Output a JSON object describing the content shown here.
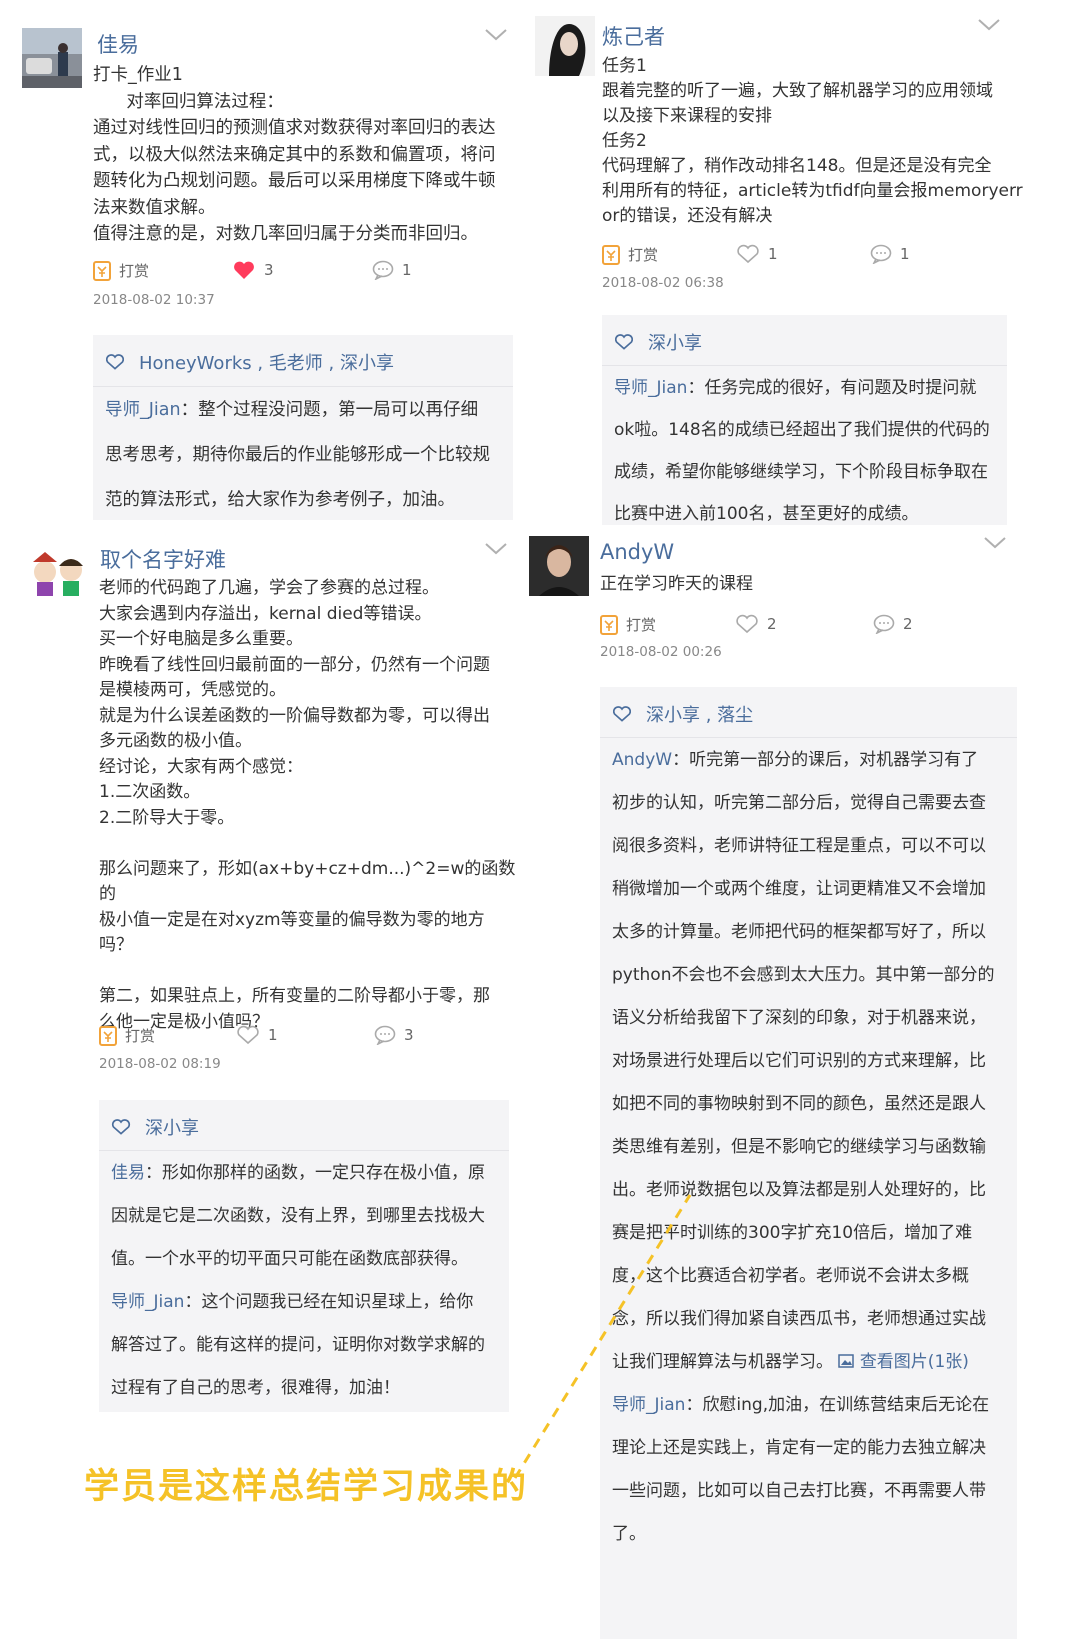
{
  "posts": [
    {
      "author": "佳易",
      "body": "打卡_作业1\n      对率回归算法过程：\n通过对线性回归的预测值求对数获得对率回归的表达\n式，以极大似然法来确定其中的系数和偏置项，将问\n题转化为凸规划问题。最后可以采用梯度下降或牛顿\n法来数值求解。\n值得注意的是，对数几率回归属于分类而非回归。",
      "reward": "打赏",
      "likes": "3",
      "comments": "1",
      "time": "2018-08-02 10:37",
      "liked_by": "HoneyWorks , 毛老师 , 深小享",
      "replies": [
        {
          "who": "导师_Jian",
          "text": "整个过程没问题，第一局可以再仔细\n思考思考，期待你最后的作业能够形成一个比较规\n范的算法形式，给大家作为参考例子，加油。"
        }
      ]
    },
    {
      "author": "炼己者",
      "body": "任务1\n跟着完整的听了一遍，大致了解机器学习的应用领域\n以及接下来课程的安排\n任务2\n代码理解了，稍作改动排名148。但是还是没有完全\n利用所有的特征，article转为tfidf向量会报memoryerr\nor的错误，还没有解决",
      "reward": "打赏",
      "likes": "1",
      "comments": "1",
      "time": "2018-08-02 06:38",
      "liked_by": "深小享",
      "replies": [
        {
          "who": "导师_Jian",
          "text": "任务完成的很好，有问题及时提问就\nok啦。148名的成绩已经超出了我们提供的代码的\n成绩，希望你能够继续学习，下个阶段目标争取在\n比赛中进入前100名，甚至更好的成绩。"
        }
      ]
    },
    {
      "author": "取个名字好难",
      "body": "老师的代码跑了几遍，学会了参赛的总过程。\n大家会遇到内存溢出，kernal died等错误。\n买一个好电脑是多么重要。\n昨晚看了线性回归最前面的一部分，仍然有一个问题\n是模棱两可，凭感觉的。\n就是为什么误差函数的一阶偏导数都为零，可以得出\n多元函数的极小值。\n经讨论，大家有两个感觉：\n1.二次函数。\n2.二阶导大于零。\n\n那么问题来了，形如(ax+by+cz+dm...)^2=w的函数的\n极小值一定是在对xyzm等变量的偏导数为零的地方\n吗？\n\n第二，如果驻点上，所有变量的二阶导都小于零，那\n么他一定是极小值吗？",
      "reward": "打赏",
      "likes": "1",
      "comments": "3",
      "time": "2018-08-02 08:19",
      "liked_by": "深小享",
      "replies": [
        {
          "who": "佳易",
          "text": "形如你那样的函数，一定只存在极小值，原\n因就是它是二次函数，没有上界，到哪里去找极大\n值。一个水平的切平面只可能在函数底部获得。"
        },
        {
          "who": "导师_Jian",
          "text": "这个问题我已经在知识星球上，给你\n解答过了。能有这样的提问，证明你对数学求解的\n过程有了自己的思考，很难得，加油！"
        }
      ]
    },
    {
      "author": "AndyW",
      "body": "正在学习昨天的课程",
      "reward": "打赏",
      "likes": "2",
      "comments": "2",
      "time": "2018-08-02 00:26",
      "liked_by": "深小享 , 落尘",
      "replies": [
        {
          "who": "AndyW",
          "text": "听完第一部分的课后，对机器学习有了\n初步的认知，听完第二部分后，觉得自己需要去查\n阅很多资料，老师讲特征工程是重点，可以不可以\n稍微增加一个或两个维度，让词更精准又不会增加\n太多的计算量。老师把代码的框架都写好了，所以\npython不会也不会感到太大压力。其中第一部分的\n语义分析给我留下了深刻的印象，对于机器来说，\n对场景进行处理后以它们可识别的方式来理解，比\n如把不同的事物映射到不同的颜色，虽然还是跟人\n类思维有差别，但是不影响它的继续学习与函数输\n出。老师说数据包以及算法都是别人处理好的，比\n赛是把平时训练的300字扩充10倍后，增加了难\n度，这个比赛适合初学者。老师说不会讲太多概\n念，所以我们得加紧自读西瓜书，老师想通过实战\n让我们理解算法与机器学习。",
          "pic_link": "查看图片(1张)"
        },
        {
          "who": "导师_Jian",
          "text": "欣慰ing,加油，在训练营结束后无论在\n理论上还是实践上，肯定有一定的能力去独立解决\n一些问题，比如可以自己去打比赛，不再需要人带\n了。"
        }
      ]
    }
  ],
  "caption": "学员是这样总结学习成果的",
  "colors": {
    "name_blue": "#4a6d9c",
    "heart_red": "#ff3b5c",
    "reward_orange": "#f2a33a",
    "caption_yellow": "#f5c227",
    "box_bg": "#f4f4f6"
  }
}
